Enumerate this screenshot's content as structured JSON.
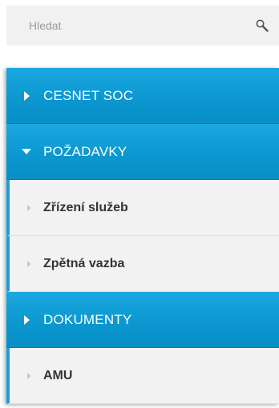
{
  "search": {
    "placeholder": "Hledat",
    "icon": "search-icon"
  },
  "colors": {
    "section_bg": "#0b96cf",
    "sub_bg": "#f2f2f2",
    "accent": "#1ba0d8"
  },
  "menu": {
    "items": [
      {
        "label": "CESNET SOC",
        "type": "section",
        "expanded": false,
        "icon": "caret-right-icon"
      },
      {
        "label": "POŽADAVKY",
        "type": "section",
        "expanded": true,
        "icon": "caret-down-icon"
      },
      {
        "label": "Zřízení služeb",
        "type": "sub",
        "icon": "small-caret-right-icon"
      },
      {
        "label": "Zpětná vazba",
        "type": "sub",
        "icon": "small-caret-right-icon"
      },
      {
        "label": "DOKUMENTY",
        "type": "section",
        "expanded": false,
        "icon": "caret-right-icon"
      },
      {
        "label": "AMU",
        "type": "sub",
        "icon": "small-caret-right-icon"
      }
    ]
  }
}
